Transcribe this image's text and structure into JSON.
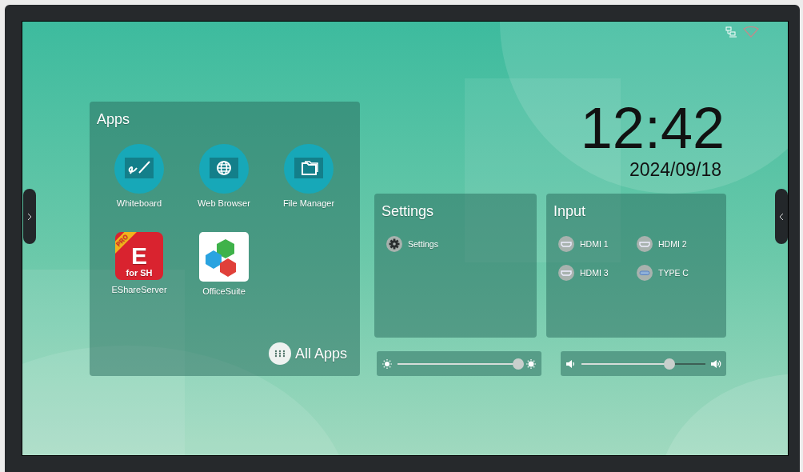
{
  "clock": {
    "time": "12:42",
    "date": "2024/09/18"
  },
  "apps_panel": {
    "title": "Apps",
    "apps": [
      {
        "label": "Whiteboard",
        "kind": "whiteboard"
      },
      {
        "label": "Web Browser",
        "kind": "browser"
      },
      {
        "label": "File Manager",
        "kind": "files"
      },
      {
        "label": "EShareServer",
        "kind": "eshare",
        "badge": "PRO",
        "logo_letter": "E",
        "logo_caption": "for SH"
      },
      {
        "label": "OfficeSuite",
        "kind": "office"
      }
    ],
    "all_apps": "All Apps"
  },
  "settings_panel": {
    "title": "Settings",
    "items": [
      {
        "label": "Settings"
      }
    ]
  },
  "input_panel": {
    "title": "Input",
    "sources": [
      {
        "label": "HDMI 1",
        "kind": "hdmi"
      },
      {
        "label": "HDMI 2",
        "kind": "hdmi"
      },
      {
        "label": "HDMI 3",
        "kind": "hdmi"
      },
      {
        "label": "TYPE C",
        "kind": "typec"
      }
    ]
  },
  "brightness": {
    "level": 0.98
  },
  "volume": {
    "level": 0.71
  }
}
